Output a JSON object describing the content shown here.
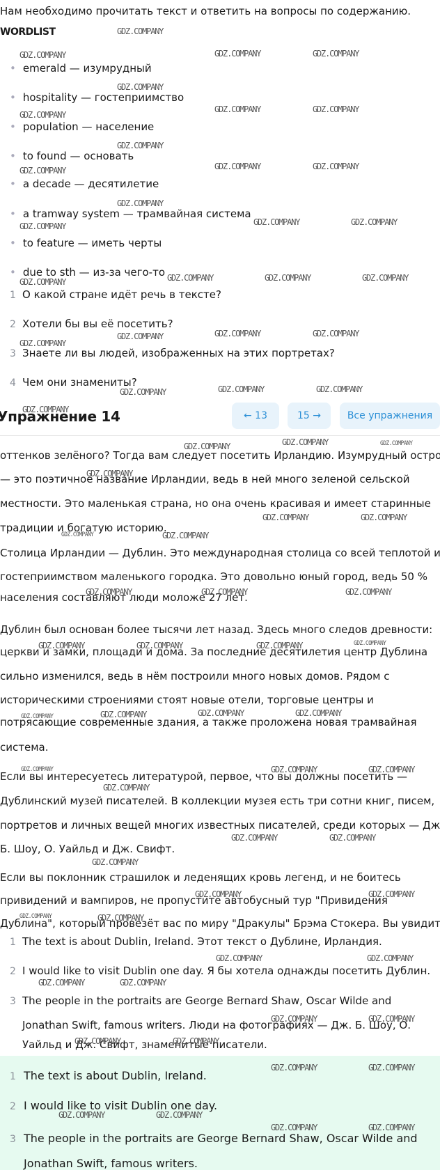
{
  "intro": "Нам необходимо прочитать текст и ответить на вопросы по содержанию.",
  "wordlist_title": "WORDLIST",
  "wordlist": [
    "emerald — изумрудный",
    "hospitality — гостеприимство",
    "population — население",
    "to found — основать",
    "a decade — десятилетие",
    "a tramway system — трамвайная система",
    "to feature — иметь черты",
    "due to sth — из-за чего-то"
  ],
  "questions": [
    {
      "num": "1",
      "text": "О какой стране идёт речь в тексте?"
    },
    {
      "num": "2",
      "text": "Хотели бы вы её посетить?"
    },
    {
      "num": "3",
      "text": "Знаете ли вы людей, изображенных на этих портретах?"
    },
    {
      "num": "4",
      "text": "Чем они знамениты?"
    }
  ],
  "header": {
    "title": "Упражнение 14",
    "prev": "← 13",
    "next": "15 →",
    "all": "Все упражнения"
  },
  "text_lines": [
    "оттенков зелёного? Тогда вам следует посетить Ирландию. Изумрудный остров",
    "— это поэтичное название Ирландии, ведь в ней много зеленой сельской",
    "местности. Это маленькая страна, но она очень красивая и имеет старинные",
    "традиции и богатую историю.",
    "Столица Ирландии — Дублин. Это международная столица со всей теплотой и",
    "гостеприимством маленького городка. Это довольно юный город, ведь 50 %",
    "населения составляют люди моложе 27 лет.",
    "Дублин был основан более тысячи лет назад. Здесь много следов древности:",
    "церкви и замки, площади и дома. За последние десятилетия центр Дублина",
    "сильно изменился, ведь в нём построили много новых домов. Рядом с",
    "историческими строениями стоят новые отели, торговые центры и",
    "потрясающие современные здания, а также проложена новая трамвайная",
    "система.",
    "Если вы интересуетесь литературой, первое, что вы должны посетить —",
    "Дублинский музей писателей. В коллекции музея есть три сотни книг, писем,",
    "портретов и личных вещей многих известных писателей, среди которых — Дж.",
    "Б. Шоу, О. Уайльд и Дж. Свифт.",
    "Если вы поклонник страшилок и леденящих кровь легенд, и не боитесь",
    "привидений и вампиров, не пропустите автобусный тур \"Привидения",
    "Дублина\", который провезёт вас по миру \"Дракулы\" Брэма Стокера. Вы увидите"
  ],
  "answers": [
    {
      "num": "1",
      "lines": [
        "The text is about Dublin, Ireland. Этот текст о Дублине, Ирландия."
      ]
    },
    {
      "num": "2",
      "lines": [
        "I would like to visit Dublin one day. Я бы хотела однажды посетить Дублин."
      ]
    },
    {
      "num": "3",
      "lines": [
        "The people in the portraits are George Bernard Shaw, Oscar Wilde and",
        "Jonathan Swift, famous writers. Люди на фотографиях — Дж. Б. Шоу, О.",
        "Уайльд и Дж. Свифт, знаменитые писатели."
      ]
    }
  ],
  "green_answers": [
    {
      "num": "1",
      "lines": [
        "The text is about Dublin, Ireland."
      ]
    },
    {
      "num": "2",
      "lines": [
        "I would like to visit Dublin one day."
      ]
    },
    {
      "num": "3",
      "lines": [
        "The people in the portraits are George Bernard Shaw, Oscar Wilde and",
        "Jonathan Swift, famous writers."
      ]
    }
  ],
  "watermark": "GDZ.COMPANY",
  "colors": {
    "accent": "#2b8fd6",
    "nav_bg": "#e8f3fb",
    "answer_bg": "#e6faf0"
  }
}
